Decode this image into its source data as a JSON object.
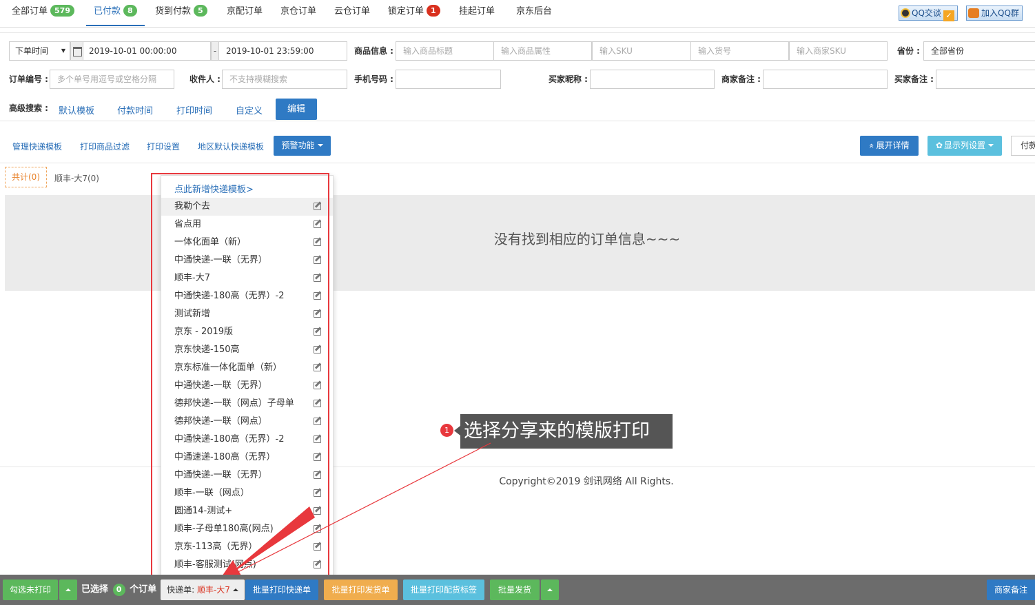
{
  "tabs": [
    {
      "label": "全部订单",
      "count": "579"
    },
    {
      "label": "已付款",
      "count": "8"
    },
    {
      "label": "货到付款",
      "count": "5"
    },
    {
      "label": "京配订单"
    },
    {
      "label": "京仓订单"
    },
    {
      "label": "云仓订单"
    },
    {
      "label": "锁定订单",
      "count": "1"
    },
    {
      "label": "挂起订单"
    },
    {
      "label": "京东后台"
    }
  ],
  "qq": {
    "chat": "QQ交谈",
    "group": "加入QQ群",
    "check": "✓"
  },
  "search": {
    "time_type": "下单时间",
    "start_time": "2019-10-01 00:00:00",
    "range_sep": "-",
    "end_time": "2019-10-01 23:59:00",
    "product_label": "商品信息 :",
    "product_title_ph": "输入商品标题",
    "product_attr_ph": "输入商品属性",
    "sku_ph": "输入SKU",
    "item_no_ph": "输入货号",
    "merchant_sku_ph": "输入商家SKU",
    "province_label": "省份 :",
    "province_value": "全部省份",
    "order_no_label": "订单编号 :",
    "order_no_ph": "多个单号用逗号或空格分隔",
    "receiver_label": "收件人 :",
    "receiver_ph": "不支持模糊搜索",
    "phone_label": "手机号码 :",
    "buyer_nick_label": "买家昵称 :",
    "merchant_note_label": "商家备注 :",
    "buyer_note_label": "买家备注 :"
  },
  "advanced": {
    "label": "高级搜索 :",
    "links": [
      "默认模板",
      "付款时间",
      "打印时间",
      "自定义"
    ],
    "edit_button": "编辑"
  },
  "toolbar": {
    "links": [
      "管理快递模板",
      "打印商品过滤",
      "打印设置",
      "地区默认快递模板"
    ],
    "warning_button": "预警功能",
    "expand_button": "展开详情",
    "expand_icon": "«",
    "columns_button": "显示列设置",
    "columns_icon": "✿",
    "cut_button": "付款"
  },
  "filters": {
    "total": "共计(0)",
    "sf": "顺丰-大7(0)"
  },
  "empty_message": "没有找到相应的订单信息~~~",
  "copyright": "Copyright©2019 剑讯网络 All Rights.",
  "dropdown": {
    "add_link": "点此新增快递模板>",
    "items": [
      "我勒个去",
      "省点用",
      "一体化面单（新）",
      "中通快递-一联（无界）",
      "顺丰-大7",
      "中通快递-180高（无界）-2",
      "测试新增",
      "京东 - 2019版",
      "京东快递-150高",
      "京东标准一体化面单（新）",
      "中通快递-一联（无界）",
      "德邦快递-一联（网点）子母单",
      "德邦快递-一联（网点）",
      "中通快递-180高（无界）-2",
      "中通速递-180高（无界）",
      "中通快递-一联（无界）",
      "顺丰-一联（网点）",
      "圆通14-测试+",
      "顺丰-子母单180高(网点)",
      "京东-113高（无界）",
      "顺丰-客服测试(网点)"
    ]
  },
  "callout": {
    "number": "1",
    "text": "选择分享来的模版打印"
  },
  "bottom": {
    "check_unprinted": "勾选未打印",
    "selected_prefix": "已选择",
    "selected_count": "0",
    "selected_suffix": "个订单",
    "express_label": "快递单:",
    "express_value": "顺丰-大7",
    "batch_print_express": "批量打印快递单",
    "batch_print_delivery": "批量打印发货单",
    "batch_print_label": "批量打印配货标签",
    "batch_ship": "批量发货",
    "merchant_note": "商家备注"
  },
  "colors": {
    "accent": "#2a6fb8",
    "highlight": "#e8383d",
    "express_value": "#d9301e"
  }
}
